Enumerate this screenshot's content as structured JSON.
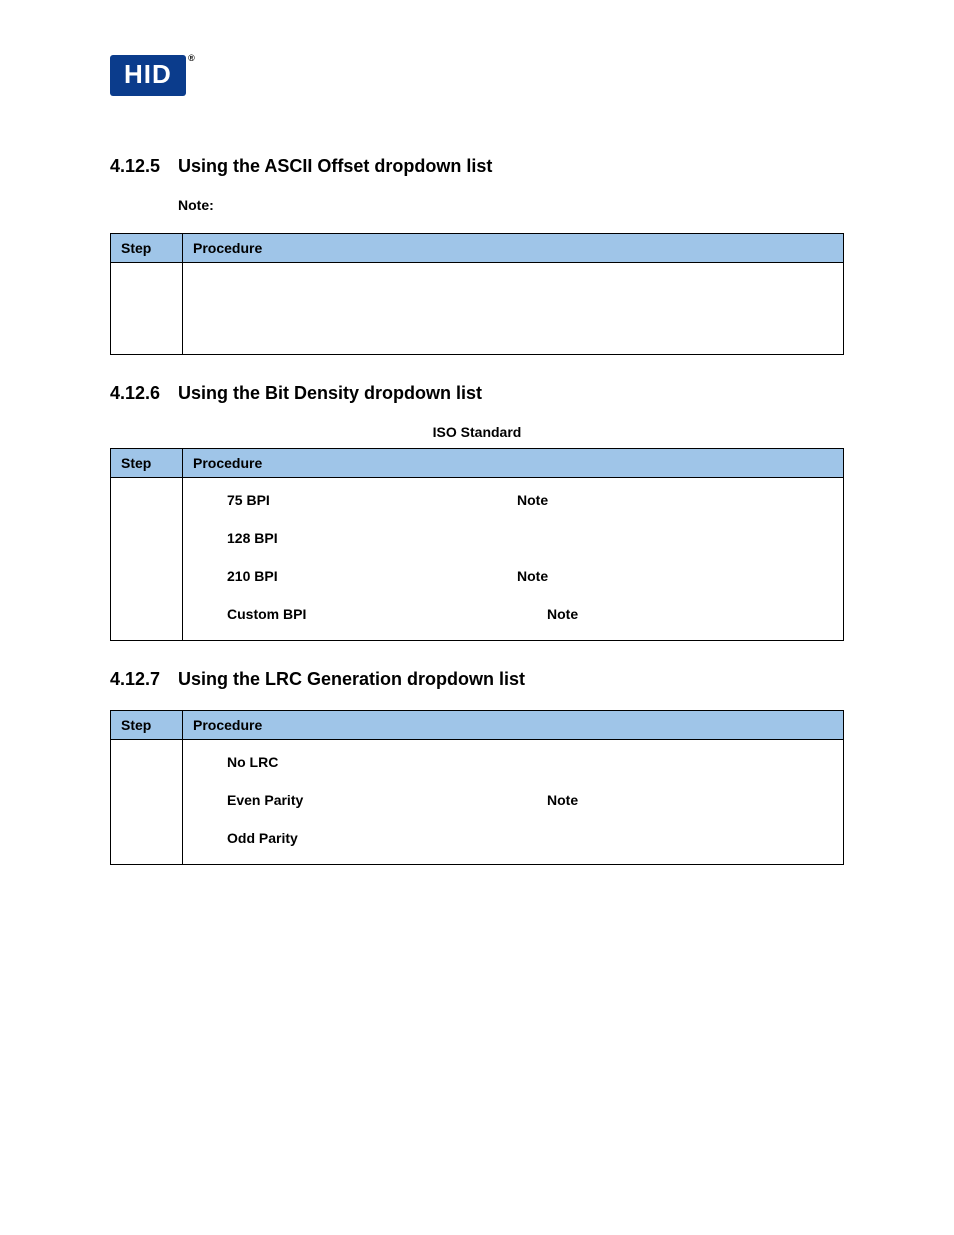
{
  "logo": {
    "text": "HID",
    "reg": "®"
  },
  "sections": {
    "s1": {
      "num": "4.12.5",
      "title": "Using the ASCII Offset dropdown list",
      "note": "Note:",
      "headers": {
        "step": "Step",
        "proc": "Procedure"
      }
    },
    "s2": {
      "num": "4.12.6",
      "title": "Using the Bit Density dropdown list",
      "iso": "ISO Standard",
      "headers": {
        "step": "Step",
        "proc": "Procedure"
      },
      "rows": [
        {
          "label": "75 BPI",
          "note": "Note"
        },
        {
          "label": "128 BPI",
          "note": ""
        },
        {
          "label": "210 BPI",
          "note": "Note"
        },
        {
          "label": "Custom BPI",
          "note": "Note"
        }
      ]
    },
    "s3": {
      "num": "4.12.7",
      "title": "Using the LRC Generation dropdown list",
      "headers": {
        "step": "Step",
        "proc": "Procedure"
      },
      "rows": [
        {
          "label": "No LRC",
          "note": ""
        },
        {
          "label": "Even Parity",
          "note": "Note"
        },
        {
          "label": "Odd Parity",
          "note": ""
        }
      ]
    }
  }
}
